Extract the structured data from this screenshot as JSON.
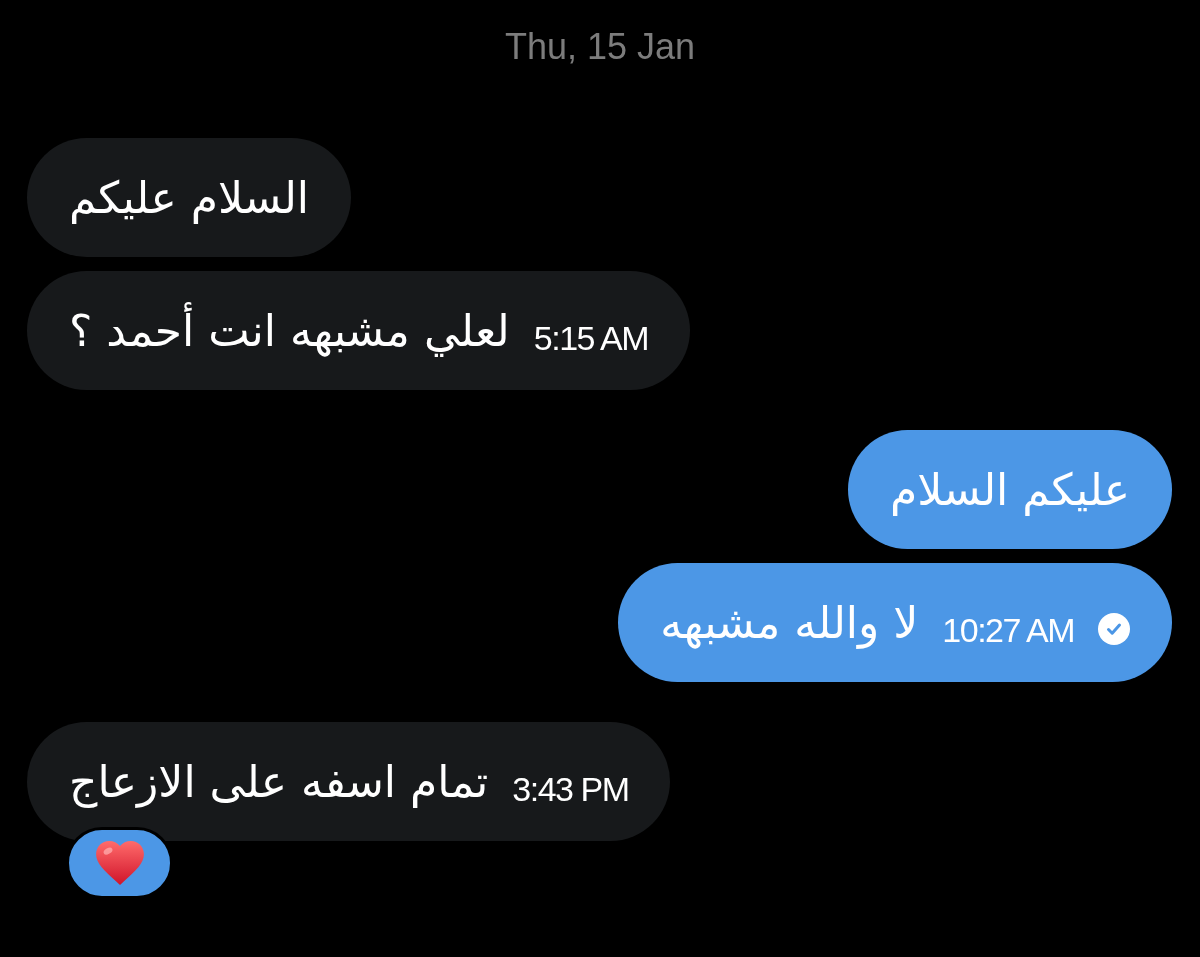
{
  "date_header": "Thu, 15 Jan",
  "messages": [
    {
      "kind": "incoming",
      "text": "السلام عليكم"
    },
    {
      "kind": "incoming",
      "text": "لعلي مشبهه انت أحمد ؟",
      "time": "5:15 AM"
    },
    {
      "kind": "outgoing",
      "text": "عليكم السلام"
    },
    {
      "kind": "outgoing",
      "text": "لا والله مشبهه",
      "time": "10:27 AM",
      "read": true
    },
    {
      "kind": "incoming",
      "text": "تمام اسفه على الازعاج",
      "time": "3:43 PM",
      "reaction": {
        "kind": "heart"
      }
    }
  ]
}
